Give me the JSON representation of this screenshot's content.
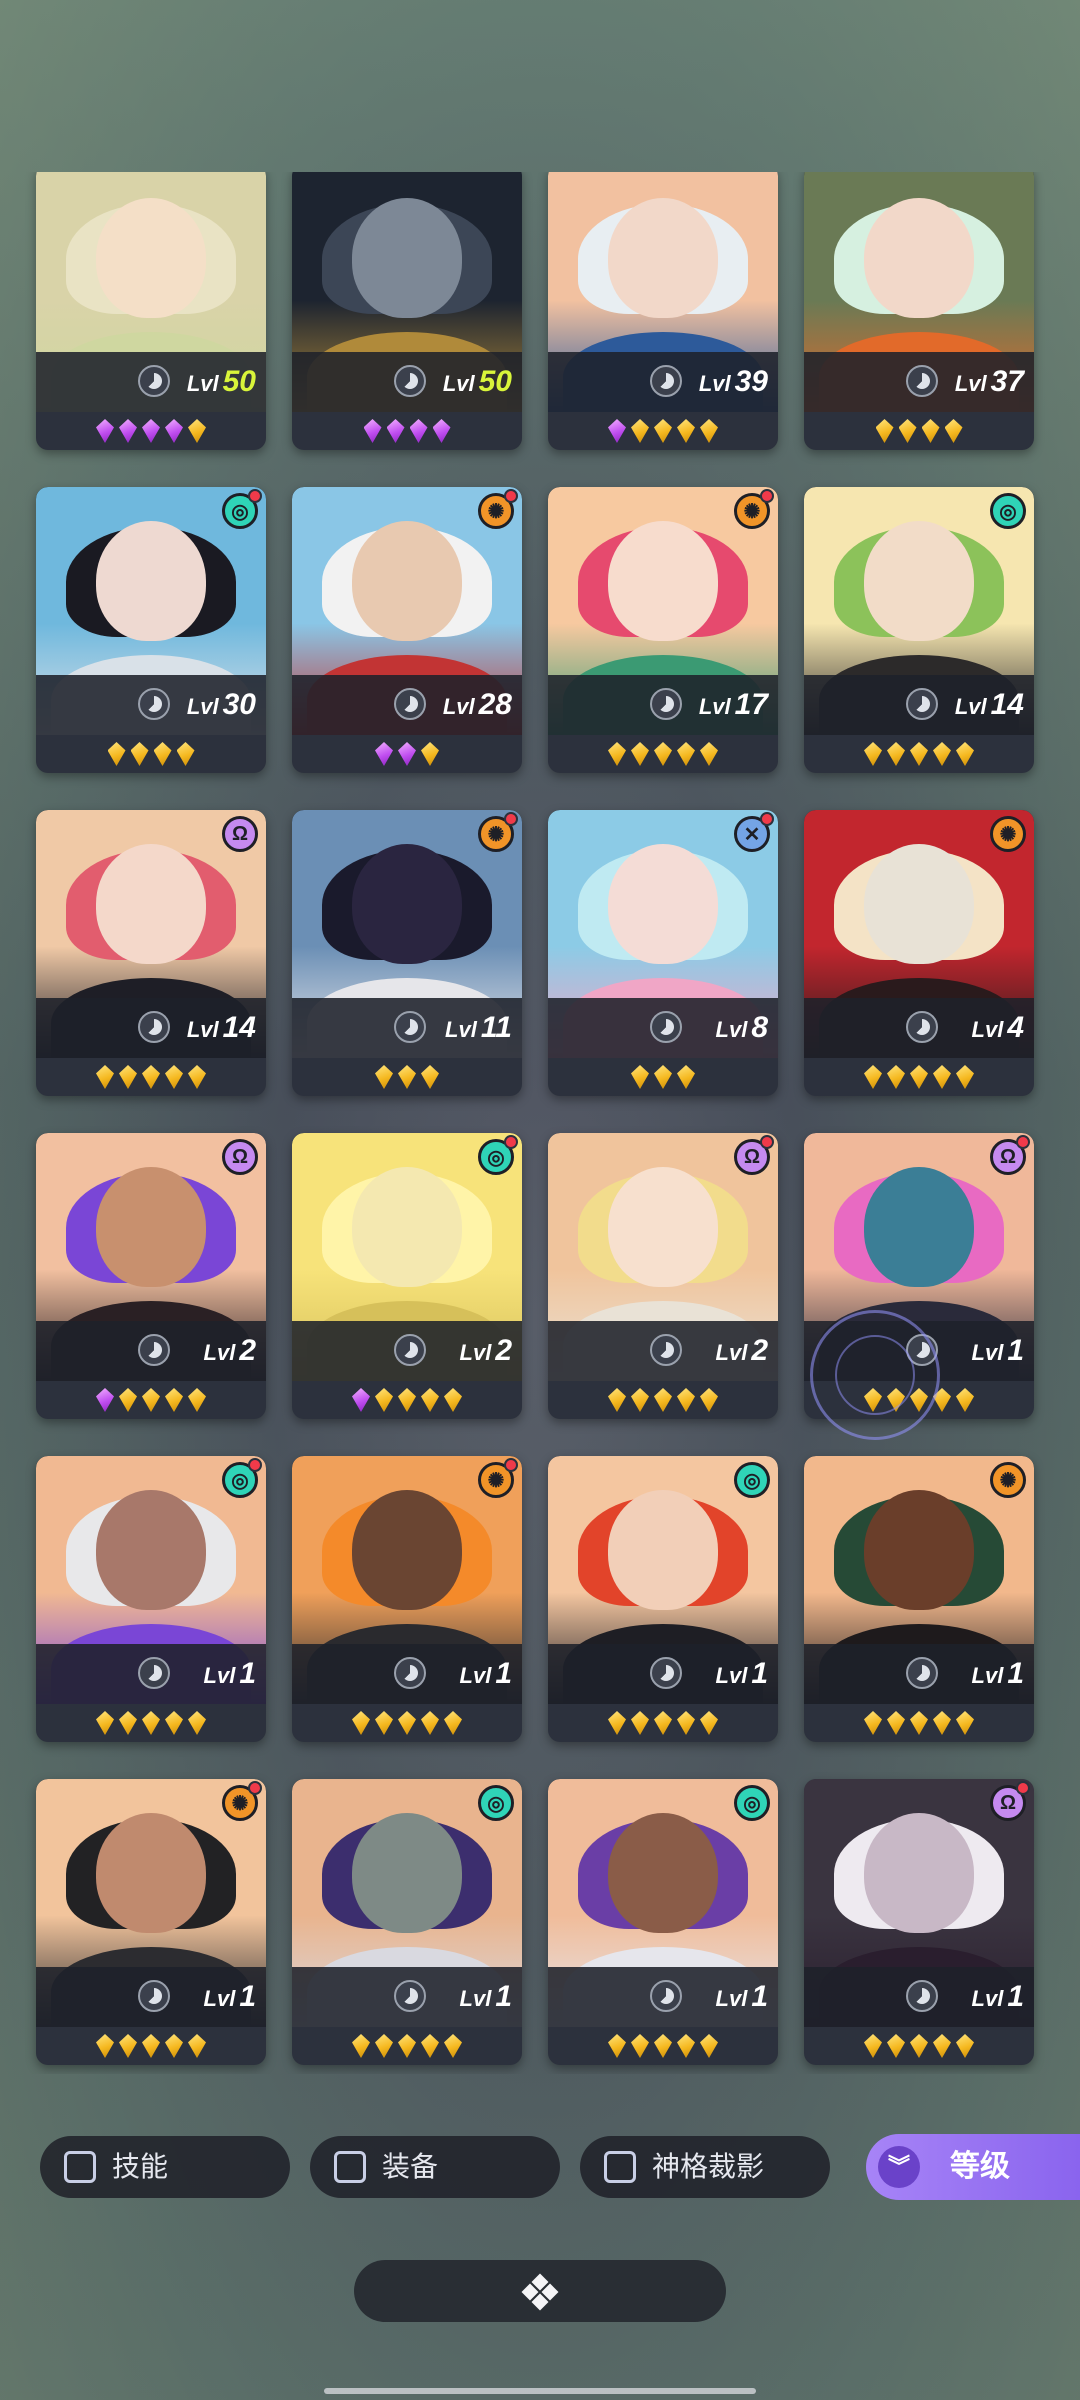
{
  "filters": [
    {
      "label": "技能",
      "checked": false
    },
    {
      "label": "装备",
      "checked": false
    },
    {
      "label": "神格裁影",
      "checked": false
    }
  ],
  "sort": {
    "label": "等级",
    "icon": "double-chevron-down-icon"
  },
  "bottom_handle": {
    "icon": "grid-dots-icon"
  },
  "level_prefix": "Lvl",
  "colors": {
    "gold_gem": "#f5b81f",
    "purple_gem": "#c04ef0",
    "level_highlight": "#d9f53a",
    "sort_button": "#9a74f3",
    "notification_dot": "#f03a4a"
  },
  "heroes": [
    {
      "level": "50",
      "gems": [
        "purple",
        "purple",
        "purple",
        "purple",
        "gold"
      ],
      "faction": null,
      "dot": false,
      "highlight": true,
      "palette": [
        "#d9d3a8",
        "#e9e3c4",
        "#f4dfc7",
        "#cfd7a0"
      ]
    },
    {
      "level": "50",
      "gems": [
        "purple",
        "purple",
        "purple",
        "purple"
      ],
      "faction": null,
      "dot": false,
      "highlight": true,
      "palette": [
        "#1d2430",
        "#3c4656",
        "#7d8896",
        "#b08a3a"
      ]
    },
    {
      "level": "39",
      "gems": [
        "purple",
        "gold",
        "gold",
        "gold",
        "gold"
      ],
      "faction": null,
      "dot": false,
      "highlight": false,
      "palette": [
        "#f2c1a0",
        "#e8eef2",
        "#f2d8c9",
        "#2d5a9a"
      ]
    },
    {
      "level": "37",
      "gems": [
        "gold",
        "gold",
        "gold",
        "gold"
      ],
      "faction": null,
      "dot": false,
      "highlight": false,
      "palette": [
        "#6a7a55",
        "#d6f0e0",
        "#f2d8c9",
        "#e26a2a"
      ]
    },
    {
      "level": "30",
      "gems": [
        "gold",
        "gold",
        "gold",
        "gold"
      ],
      "faction": "teal",
      "dot": true,
      "highlight": false,
      "palette": [
        "#6fb8dd",
        "#1a1a22",
        "#eed9d1",
        "#d9e1e8"
      ]
    },
    {
      "level": "28",
      "gems": [
        "purple",
        "purple",
        "gold"
      ],
      "faction": "orange",
      "dot": true,
      "highlight": false,
      "palette": [
        "#8ac6e6",
        "#f2f2f2",
        "#e8c9b0",
        "#c23434"
      ]
    },
    {
      "level": "17",
      "gems": [
        "gold",
        "gold",
        "gold",
        "gold",
        "gold"
      ],
      "faction": "orange",
      "dot": true,
      "highlight": false,
      "palette": [
        "#f7c9a0",
        "#e64a6e",
        "#f7dccd",
        "#3b9a73"
      ]
    },
    {
      "level": "14",
      "gems": [
        "gold",
        "gold",
        "gold",
        "gold",
        "gold"
      ],
      "faction": "teal",
      "dot": false,
      "highlight": false,
      "palette": [
        "#f6e6b0",
        "#8cc25a",
        "#f2dcc8",
        "#2c2a2a"
      ]
    },
    {
      "level": "14",
      "gems": [
        "gold",
        "gold",
        "gold",
        "gold",
        "gold"
      ],
      "faction": "purple",
      "dot": false,
      "highlight": false,
      "palette": [
        "#f0c9a6",
        "#e25d6e",
        "#f4d8ca",
        "#1e1e26"
      ]
    },
    {
      "level": "11",
      "gems": [
        "gold",
        "gold",
        "gold"
      ],
      "faction": "orange",
      "dot": true,
      "highlight": false,
      "palette": [
        "#6b8fb5",
        "#1a1a2c",
        "#2a2540",
        "#e6e6ea"
      ]
    },
    {
      "level": "8",
      "gems": [
        "gold",
        "gold",
        "gold"
      ],
      "faction": "blue",
      "dot": true,
      "highlight": false,
      "palette": [
        "#8ccbe6",
        "#bfeaf2",
        "#f4dcd6",
        "#f0a6c6"
      ]
    },
    {
      "level": "4",
      "gems": [
        "gold",
        "gold",
        "gold",
        "gold",
        "gold"
      ],
      "faction": "orange",
      "dot": false,
      "highlight": false,
      "palette": [
        "#c2262e",
        "#f4e3c6",
        "#e8e2d6",
        "#2a1a1c"
      ]
    },
    {
      "level": "2",
      "gems": [
        "purple",
        "gold",
        "gold",
        "gold",
        "gold"
      ],
      "faction": "purple",
      "dot": false,
      "highlight": false,
      "palette": [
        "#f2c0a0",
        "#7a46d6",
        "#c8906e",
        "#2a2024"
      ]
    },
    {
      "level": "2",
      "gems": [
        "purple",
        "gold",
        "gold",
        "gold",
        "gold"
      ],
      "faction": "teal",
      "dot": true,
      "highlight": false,
      "palette": [
        "#f7e37a",
        "#fff4a8",
        "#f4e8b0",
        "#d6c05a"
      ]
    },
    {
      "level": "2",
      "gems": [
        "gold",
        "gold",
        "gold",
        "gold",
        "gold"
      ],
      "faction": "purple",
      "dot": true,
      "highlight": false,
      "palette": [
        "#f0c49c",
        "#f2dc8c",
        "#f7e0ce",
        "#e9e2d6"
      ]
    },
    {
      "level": "1",
      "gems": [
        "gold",
        "gold",
        "gold",
        "gold",
        "gold"
      ],
      "faction": "purple",
      "dot": true,
      "highlight": false,
      "palette": [
        "#f0b89a",
        "#e86ac2",
        "#3b7e96",
        "#2a2a3a"
      ]
    },
    {
      "level": "1",
      "gems": [
        "gold",
        "gold",
        "gold",
        "gold",
        "gold"
      ],
      "faction": "teal",
      "dot": true,
      "highlight": false,
      "palette": [
        "#f1b992",
        "#e8e8ea",
        "#a8786a",
        "#7a46d6"
      ]
    },
    {
      "level": "1",
      "gems": [
        "gold",
        "gold",
        "gold",
        "gold",
        "gold"
      ],
      "faction": "orange",
      "dot": true,
      "highlight": false,
      "palette": [
        "#f0a05a",
        "#f48a2a",
        "#6a4532",
        "#2a2a2e"
      ]
    },
    {
      "level": "1",
      "gems": [
        "gold",
        "gold",
        "gold",
        "gold",
        "gold"
      ],
      "faction": "teal",
      "dot": false,
      "highlight": false,
      "palette": [
        "#f4c6a0",
        "#e2442a",
        "#f2cfb8",
        "#1e1e24"
      ]
    },
    {
      "level": "1",
      "gems": [
        "gold",
        "gold",
        "gold",
        "gold",
        "gold"
      ],
      "faction": "orange",
      "dot": false,
      "highlight": false,
      "palette": [
        "#f2b88c",
        "#264a36",
        "#6a3e2a",
        "#1e1a1c"
      ]
    },
    {
      "level": "1",
      "gems": [
        "gold",
        "gold",
        "gold",
        "gold",
        "gold"
      ],
      "faction": "orange",
      "dot": true,
      "highlight": false,
      "palette": [
        "#f2c49c",
        "#222224",
        "#c08a6e",
        "#2c2c30"
      ]
    },
    {
      "level": "1",
      "gems": [
        "gold",
        "gold",
        "gold",
        "gold",
        "gold"
      ],
      "faction": "teal",
      "dot": false,
      "highlight": false,
      "palette": [
        "#e9b48e",
        "#3c2e6e",
        "#7e8a86",
        "#d9d9e0"
      ]
    },
    {
      "level": "1",
      "gems": [
        "gold",
        "gold",
        "gold",
        "gold",
        "gold"
      ],
      "faction": "teal",
      "dot": false,
      "highlight": false,
      "palette": [
        "#f0bc9a",
        "#6a3ea6",
        "#8a5c48",
        "#e6e6ec"
      ]
    },
    {
      "level": "1",
      "gems": [
        "gold",
        "gold",
        "gold",
        "gold",
        "gold"
      ],
      "faction": "purple",
      "dot": true,
      "highlight": false,
      "palette": [
        "#3a3440",
        "#eeeaf0",
        "#c8b8c6",
        "#2a1e2e"
      ]
    },
    {
      "level": "",
      "gems": [],
      "faction": "orange",
      "dot": false,
      "highlight": false,
      "palette": [
        "#f2c49c",
        "#c9b46a",
        "#e8d0b8",
        "#3a3a40"
      ]
    },
    {
      "level": "",
      "gems": [],
      "faction": "teal",
      "dot": false,
      "highlight": false,
      "palette": [
        "#8ab0e0",
        "#6c8cc8",
        "#e8d4c0",
        "#2e3a5a"
      ]
    },
    {
      "level": "",
      "gems": [],
      "faction": "purple",
      "dot": true,
      "highlight": false,
      "palette": [
        "#f2b8a0",
        "#f4c0b0",
        "#f2d4c4",
        "#e6a090"
      ]
    },
    {
      "level": "",
      "gems": [],
      "faction": "purple",
      "dot": false,
      "highlight": false,
      "palette": [
        "#f0e6a0",
        "#6e5a8a",
        "#e8dcc0",
        "#2a2630"
      ]
    }
  ]
}
